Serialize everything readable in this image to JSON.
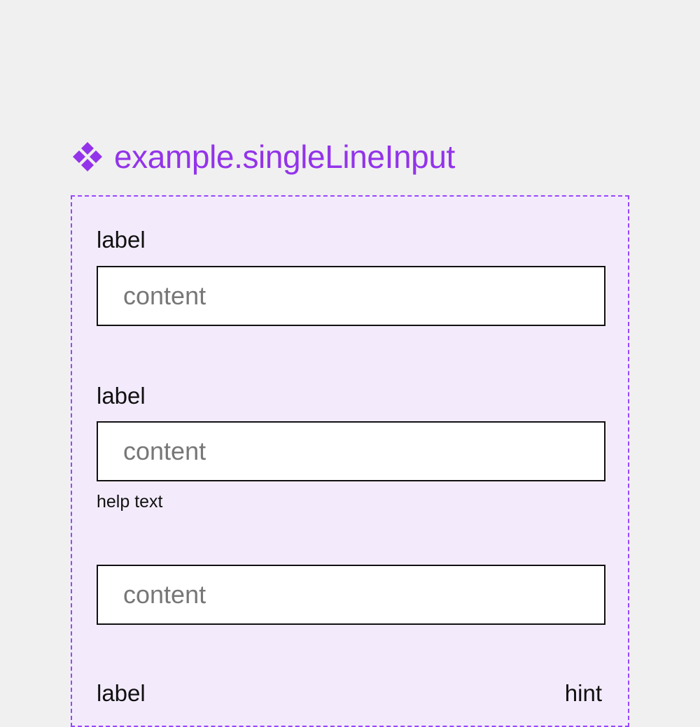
{
  "component": {
    "icon": "component-diamond-icon",
    "name": "example.singleLineInput",
    "accent_color": "#9333ea",
    "frame_color": "#f3ebfc"
  },
  "fields": [
    {
      "label": "label",
      "placeholder": "content"
    },
    {
      "label": "label",
      "placeholder": "content",
      "help_text": "help text"
    },
    {
      "placeholder": "content"
    },
    {
      "label": "label",
      "hint": "hint"
    }
  ]
}
